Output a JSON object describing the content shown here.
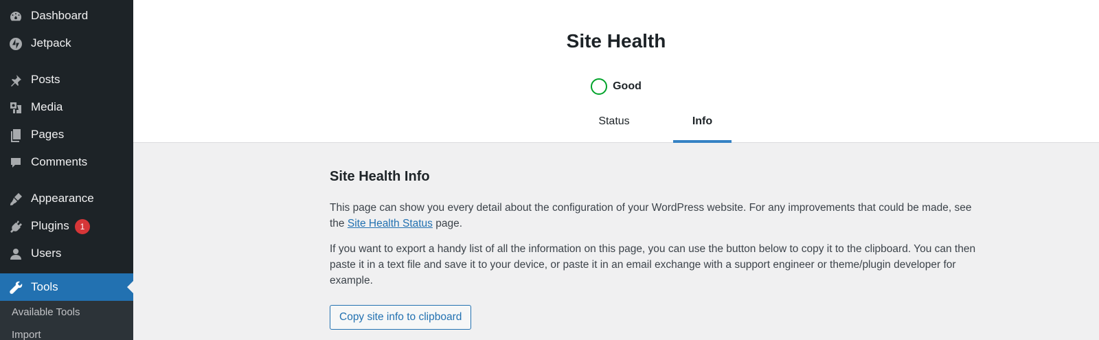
{
  "sidebar": {
    "items": [
      {
        "label": "Dashboard",
        "icon": "dashboard-icon"
      },
      {
        "label": "Jetpack",
        "icon": "jetpack-icon"
      },
      {
        "label": "Posts",
        "icon": "pin-icon"
      },
      {
        "label": "Media",
        "icon": "media-icon"
      },
      {
        "label": "Pages",
        "icon": "pages-icon"
      },
      {
        "label": "Comments",
        "icon": "comment-icon"
      },
      {
        "label": "Appearance",
        "icon": "brush-icon"
      },
      {
        "label": "Plugins",
        "icon": "plugin-icon",
        "badge": "1"
      },
      {
        "label": "Users",
        "icon": "user-icon"
      },
      {
        "label": "Tools",
        "icon": "wrench-icon",
        "active": true
      }
    ],
    "submenu": [
      "Available Tools",
      "Import"
    ]
  },
  "header": {
    "title": "Site Health",
    "status": "Good",
    "tabs": [
      {
        "label": "Status"
      },
      {
        "label": "Info",
        "active": true
      }
    ]
  },
  "main": {
    "title": "Site Health Info",
    "para1_start": "This page can show you every detail about the configuration of your WordPress website. For any improvements that could be made, see the ",
    "para1_link": "Site Health Status",
    "para1_end": " page.",
    "para2": "If you want to export a handy list of all the information on this page, you can use the button below to copy it to the clipboard. You can then paste it in a text file and save it to your device, or paste it in an email exchange with a support engineer or theme/plugin developer for example.",
    "copy_button": "Copy site info to clipboard"
  },
  "colors": {
    "sidebar_bg": "#1d2327",
    "accent": "#2271b1",
    "good": "#00a32a",
    "badge": "#d63638"
  }
}
